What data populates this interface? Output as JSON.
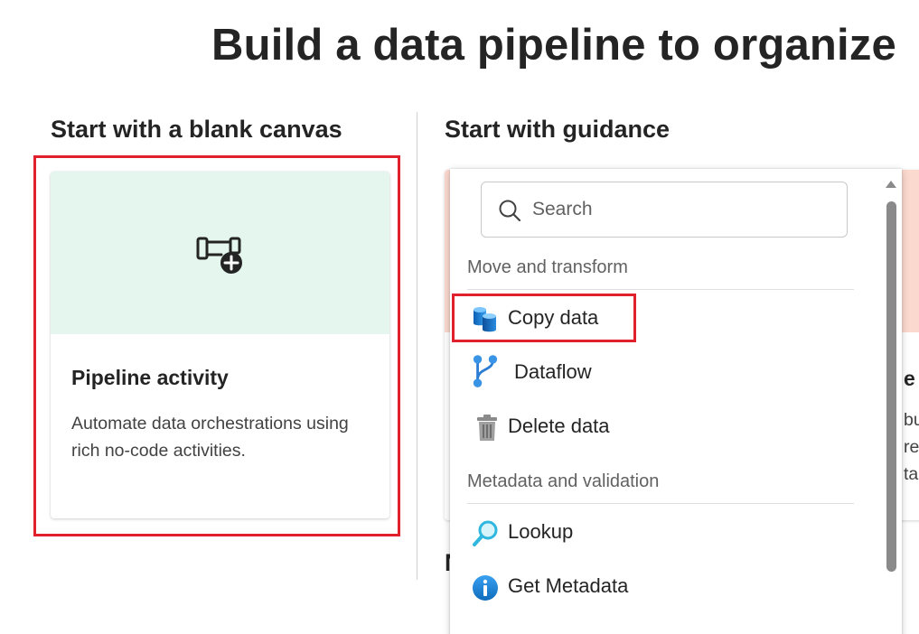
{
  "page": {
    "title": "Build a data pipeline to organize"
  },
  "blank_canvas": {
    "heading": "Start with a blank canvas",
    "card": {
      "title": "Pipeline activity",
      "description": "Automate data orchestrations using rich no-code activities.",
      "icon": "pipeline-add-icon",
      "accent_color": "#e4f6ed"
    }
  },
  "guidance": {
    "heading": "Start with guidance",
    "peek_title": "e",
    "peek_lines": [
      "bu",
      "re",
      "ta"
    ],
    "peek_next_heading": "N",
    "accent_color": "#fbd9cf"
  },
  "dropdown": {
    "search": {
      "placeholder": "Search",
      "value": ""
    },
    "groups": [
      {
        "label": "Move and transform",
        "items": [
          {
            "label": "Copy data",
            "icon": "copy-data-icon"
          },
          {
            "label": "Dataflow",
            "icon": "dataflow-icon"
          },
          {
            "label": "Delete data",
            "icon": "trash-icon"
          }
        ]
      },
      {
        "label": "Metadata and validation",
        "items": [
          {
            "label": "Lookup",
            "icon": "lookup-icon"
          },
          {
            "label": "Get Metadata",
            "icon": "info-icon"
          }
        ]
      }
    ]
  },
  "colors": {
    "highlight": "#e0202c",
    "text": "#242424",
    "muted_text": "#616161",
    "scrollbar": "#8a8a8a"
  }
}
